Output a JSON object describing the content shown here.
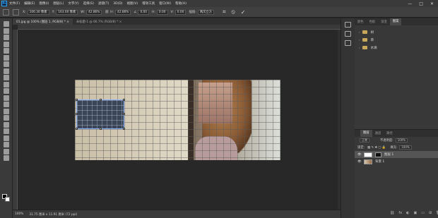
{
  "menubar": {
    "logo": "Ps",
    "items": [
      "文件(F)",
      "编辑(E)",
      "图像(I)",
      "图层(L)",
      "文字(Y)",
      "选择(S)",
      "滤镜(T)",
      "3D(D)",
      "视图(V)",
      "增效工具",
      "窗口(W)",
      "帮助(H)"
    ],
    "window_controls": [
      "—",
      "□",
      "✕"
    ]
  },
  "options": {
    "x_label": "X:",
    "x_value": "106.30 像素",
    "y_label": "Y:",
    "y_value": "163.00 像素",
    "w_label": "W:",
    "w_value": "42.86%",
    "h_label": "H:",
    "h_value": "42.86%",
    "angle_value": "0.00",
    "hskew_label": "H:",
    "hskew_value": "0.00",
    "vskew_label": "V:",
    "vskew_value": "0.00",
    "interp_label": "插值:",
    "interp_value": "两次立方",
    "cancel": "⦸",
    "commit": "✓"
  },
  "tabs": [
    {
      "label": "01.jpg @ 100% (图层 1, RGB/8) *  ×",
      "active": true
    },
    {
      "label": "未标题-1 @ 66.7% (RGB/8) *  ×",
      "active": false
    }
  ],
  "status": {
    "zoom": "100%",
    "doc_size": "31.75 厘米 x 11.91 厘米 (72 ppi)"
  },
  "panel": {
    "top_tabs": [
      "颜色",
      "色板",
      "渐变",
      "图案"
    ],
    "folders": [
      "树",
      "草",
      "水滴"
    ],
    "layer_tabs": [
      "图层",
      "通道",
      "路径"
    ],
    "blend_mode": "正常",
    "opacity_label": "不透明度:",
    "opacity_value": "100%",
    "lock_label": "锁定:",
    "fill_label": "填充:",
    "fill_value": "100%",
    "layers": [
      {
        "name": "图层 1",
        "selected": true
      },
      {
        "name": "背景 1",
        "selected": false
      }
    ],
    "footer_icons": [
      "⛓",
      "fx",
      "◐",
      "▣",
      "▭",
      "⊞",
      "🗑"
    ]
  }
}
